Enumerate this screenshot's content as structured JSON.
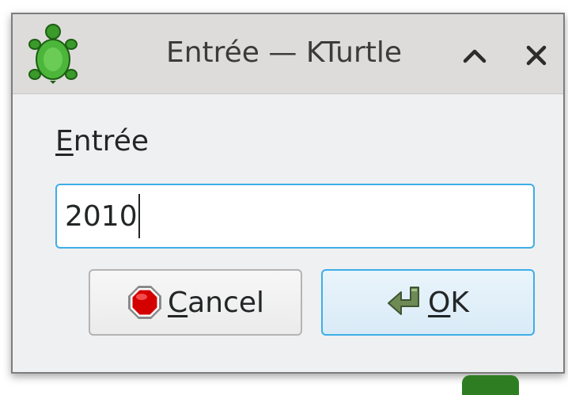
{
  "window": {
    "title": "Entrée — KTurtle",
    "app_icon": "kturtle-turtle-icon",
    "controls": [
      "minimize-chevron-up-icon",
      "close-x-icon"
    ]
  },
  "form": {
    "label_mnemonic": "E",
    "label_rest": "ntrée",
    "input_value": "2010"
  },
  "buttons": {
    "cancel": {
      "mnemonic": "C",
      "rest": "ancel",
      "icon": "stop-sign-icon"
    },
    "ok": {
      "mnemonic": "O",
      "rest": "K",
      "icon": "enter-arrow-icon"
    }
  },
  "colors": {
    "accent": "#3daee9",
    "titlebar": "#dedcda",
    "window_bg": "#eff0f1",
    "turtle_green": "#2e9d23",
    "stop_red": "#d40000"
  }
}
